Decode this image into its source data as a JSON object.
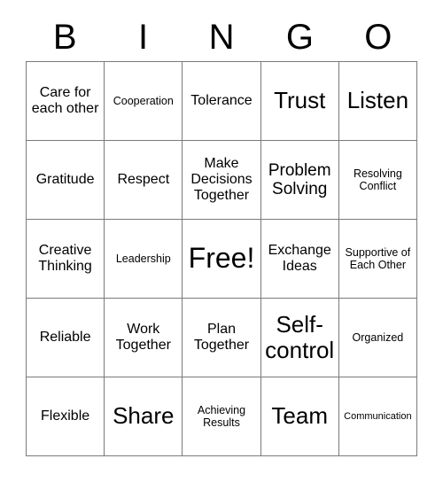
{
  "header": {
    "letters": [
      "B",
      "I",
      "N",
      "G",
      "O"
    ]
  },
  "grid": {
    "rows": 5,
    "columns": 5,
    "border_color": "#7a7a7a",
    "background_color": "#ffffff",
    "text_color": "#000000",
    "cells": [
      [
        {
          "text": "Care for each other",
          "size": "md"
        },
        {
          "text": "Cooperation",
          "size": "sm"
        },
        {
          "text": "Tolerance",
          "size": "md"
        },
        {
          "text": "Trust",
          "size": "xl"
        },
        {
          "text": "Listen",
          "size": "xl"
        }
      ],
      [
        {
          "text": "Gratitude",
          "size": "md"
        },
        {
          "text": "Respect",
          "size": "md"
        },
        {
          "text": "Make Decisions Together",
          "size": "md"
        },
        {
          "text": "Problem Solving",
          "size": "lg"
        },
        {
          "text": "Resolving Conflict",
          "size": "sm"
        }
      ],
      [
        {
          "text": "Creative Thinking",
          "size": "md"
        },
        {
          "text": "Leadership",
          "size": "sm"
        },
        {
          "text": "Free!",
          "size": "xxl"
        },
        {
          "text": "Exchange Ideas",
          "size": "md"
        },
        {
          "text": "Supportive of Each Other",
          "size": "sm"
        }
      ],
      [
        {
          "text": "Reliable",
          "size": "md"
        },
        {
          "text": "Work Together",
          "size": "md"
        },
        {
          "text": "Plan Together",
          "size": "md"
        },
        {
          "text": "Self-control",
          "size": "xl"
        },
        {
          "text": "Organized",
          "size": "sm"
        }
      ],
      [
        {
          "text": "Flexible",
          "size": "md"
        },
        {
          "text": "Share",
          "size": "xl"
        },
        {
          "text": "Achieving Results",
          "size": "sm"
        },
        {
          "text": "Team",
          "size": "xl"
        },
        {
          "text": "Communication",
          "size": "xs"
        }
      ]
    ]
  }
}
